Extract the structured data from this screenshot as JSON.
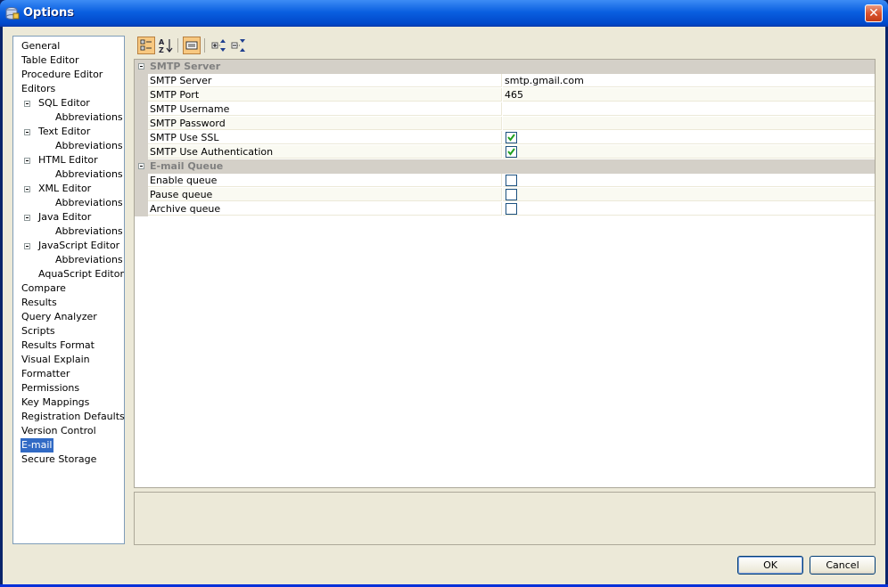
{
  "window": {
    "title": "Options",
    "icon": "options-app-icon",
    "close_icon": "close-icon"
  },
  "tree": {
    "items": [
      {
        "label": "General",
        "level": 0,
        "expander": false
      },
      {
        "label": "Table Editor",
        "level": 0,
        "expander": false
      },
      {
        "label": "Procedure Editor",
        "level": 0,
        "expander": false
      },
      {
        "label": "Editors",
        "level": 0,
        "expander": false
      },
      {
        "label": "SQL Editor",
        "level": 1,
        "expander": true
      },
      {
        "label": "Abbreviations",
        "level": 2,
        "expander": false
      },
      {
        "label": "Text Editor",
        "level": 1,
        "expander": true
      },
      {
        "label": "Abbreviations",
        "level": 2,
        "expander": false
      },
      {
        "label": "HTML Editor",
        "level": 1,
        "expander": true
      },
      {
        "label": "Abbreviations",
        "level": 2,
        "expander": false
      },
      {
        "label": "XML Editor",
        "level": 1,
        "expander": true
      },
      {
        "label": "Abbreviations",
        "level": 2,
        "expander": false
      },
      {
        "label": "Java Editor",
        "level": 1,
        "expander": true
      },
      {
        "label": "Abbreviations",
        "level": 2,
        "expander": false
      },
      {
        "label": "JavaScript Editor",
        "level": 1,
        "expander": true
      },
      {
        "label": "Abbreviations",
        "level": 2,
        "expander": false
      },
      {
        "label": "AquaScript Editor",
        "level": 1,
        "expander": false
      },
      {
        "label": "Compare",
        "level": 0,
        "expander": false
      },
      {
        "label": "Results",
        "level": 0,
        "expander": false
      },
      {
        "label": "Query Analyzer",
        "level": 0,
        "expander": false
      },
      {
        "label": "Scripts",
        "level": 0,
        "expander": false
      },
      {
        "label": "Results Format",
        "level": 0,
        "expander": false
      },
      {
        "label": "Visual Explain",
        "level": 0,
        "expander": false
      },
      {
        "label": "Formatter",
        "level": 0,
        "expander": false
      },
      {
        "label": "Permissions",
        "level": 0,
        "expander": false
      },
      {
        "label": "Key Mappings",
        "level": 0,
        "expander": false
      },
      {
        "label": "Registration Defaults",
        "level": 0,
        "expander": false
      },
      {
        "label": "Version Control",
        "level": 0,
        "expander": false
      },
      {
        "label": "E-mail",
        "level": 0,
        "expander": false,
        "selected": true
      },
      {
        "label": "Secure Storage",
        "level": 0,
        "expander": false
      }
    ]
  },
  "toolbar": {
    "buttons": [
      {
        "name": "categorized-view-button",
        "icon": "categorized-icon",
        "active": true
      },
      {
        "name": "alphabetical-sort-button",
        "icon": "sort-az-icon",
        "active": false
      },
      {
        "name": "property-pages-button",
        "icon": "property-pages-icon",
        "active": true
      },
      {
        "name": "expand-all-button",
        "icon": "expand-all-icon",
        "active": false
      },
      {
        "name": "collapse-all-button",
        "icon": "collapse-all-icon",
        "active": false
      }
    ]
  },
  "property_grid": {
    "categories": [
      {
        "label": "SMTP Server",
        "properties": [
          {
            "name": "SMTP Server",
            "value": "smtp.gmail.com",
            "type": "text"
          },
          {
            "name": "SMTP Port",
            "value": "465",
            "type": "text"
          },
          {
            "name": "SMTP Username",
            "value": "",
            "type": "text"
          },
          {
            "name": "SMTP Password",
            "value": "",
            "type": "text"
          },
          {
            "name": "SMTP Use SSL",
            "checked": true,
            "type": "checkbox"
          },
          {
            "name": "SMTP Use Authentication",
            "checked": true,
            "type": "checkbox"
          }
        ]
      },
      {
        "label": "E-mail Queue",
        "properties": [
          {
            "name": "Enable queue",
            "checked": false,
            "type": "checkbox"
          },
          {
            "name": "Pause queue",
            "checked": false,
            "type": "checkbox"
          },
          {
            "name": "Archive queue",
            "checked": false,
            "type": "checkbox"
          }
        ]
      }
    ]
  },
  "buttons": {
    "ok": "OK",
    "cancel": "Cancel"
  },
  "colors": {
    "selection": "#316ac5",
    "dialog_bg": "#ece9d8",
    "titlebar": "#0a5fe0",
    "checkmark": "#21a121"
  }
}
